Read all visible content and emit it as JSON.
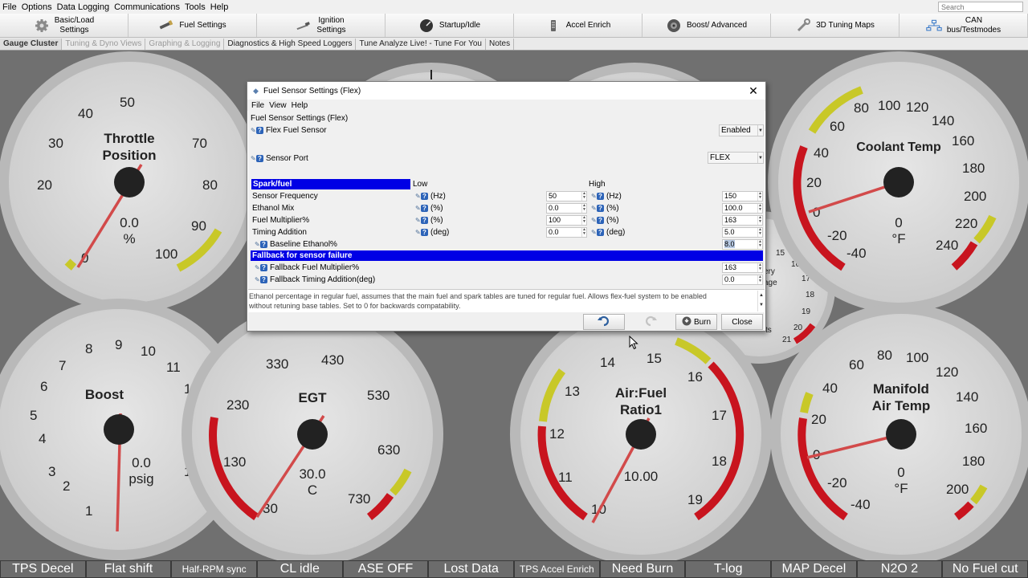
{
  "menubar": [
    "File",
    "Options",
    "Data Logging",
    "Communications",
    "Tools",
    "Help"
  ],
  "search_placeholder": "Search",
  "toolbar": [
    {
      "label": "Basic/Load\nSettings",
      "icon": "gear-icon"
    },
    {
      "label": "Fuel Settings",
      "icon": "fuel-injector-icon"
    },
    {
      "label": "Ignition\nSettings",
      "icon": "spark-plug-icon"
    },
    {
      "label": "Startup/Idle",
      "icon": "gauge-icon"
    },
    {
      "label": "Accel Enrich",
      "icon": "pedal-icon"
    },
    {
      "label": "Boost/ Advanced",
      "icon": "turbo-icon"
    },
    {
      "label": "3D Tuning Maps",
      "icon": "wrench-icon"
    },
    {
      "label": "CAN\nbus/Testmodes",
      "icon": "network-icon"
    }
  ],
  "subtabs": [
    {
      "label": "Gauge Cluster",
      "state": "active"
    },
    {
      "label": "Tuning & Dyno Views",
      "state": "dim"
    },
    {
      "label": "Graphing & Logging",
      "state": "dim"
    },
    {
      "label": "Diagnostics & High Speed Loggers",
      "state": "norm"
    },
    {
      "label": "Tune Analyze Live! - Tune For You",
      "state": "norm"
    },
    {
      "label": "Notes",
      "state": "norm"
    }
  ],
  "gauges": {
    "throttle": {
      "title1": "Throttle",
      "title2": "Position",
      "value": "0.0",
      "unit": "%",
      "ticks": [
        "0",
        "20",
        "30",
        "40",
        "50",
        "70",
        "80",
        "90",
        "100"
      ]
    },
    "coolant": {
      "title": "Coolant Temp",
      "value": "0",
      "unit": "°F",
      "ticks": [
        "-40",
        "-20",
        "0",
        "20",
        "40",
        "60",
        "80",
        "100",
        "120",
        "140",
        "160",
        "180",
        "200",
        "220",
        "240"
      ]
    },
    "boost": {
      "title": "Boost",
      "value": "0.0",
      "unit": "psig",
      "ticks": [
        "1",
        "2",
        "3",
        "4",
        "5",
        "6",
        "7",
        "8",
        "9",
        "10",
        "11",
        "12",
        "15"
      ]
    },
    "egt": {
      "title": "EGT",
      "value": "30.0",
      "unit": "C",
      "ticks": [
        "30",
        "130",
        "230",
        "330",
        "430",
        "530",
        "630",
        "730"
      ]
    },
    "afr": {
      "title1": "Air:Fuel",
      "title2": "Ratio1",
      "value": "10.00",
      "ticks": [
        "10",
        "11",
        "12",
        "13",
        "14",
        "15",
        "16",
        "17",
        "18",
        "19"
      ]
    },
    "mat": {
      "title1": "Manifold",
      "title2": "Air Temp",
      "value": "0",
      "unit": "°F",
      "ticks": [
        "-40",
        "-20",
        "0",
        "20",
        "40",
        "60",
        "80",
        "100",
        "120",
        "140",
        "160",
        "180",
        "200"
      ]
    },
    "battery": {
      "ticks": [
        "15",
        "16",
        "17",
        "18",
        "19",
        "20",
        "21"
      ],
      "label_fragments": [
        "ery",
        "age",
        "ts"
      ]
    }
  },
  "indicators": [
    "TPS Decel",
    "Flat shift",
    "Half-RPM sync",
    "CL idle",
    "ASE OFF",
    "Lost Data",
    "TPS Accel Enrich",
    "Need Burn",
    "T-log",
    "MAP Decel",
    "N2O 2",
    "No Fuel cut"
  ],
  "dialog": {
    "title": "Fuel Sensor Settings (Flex)",
    "menu": [
      "File",
      "View",
      "Help"
    ],
    "heading": "Fuel Sensor Settings (Flex)",
    "flex_label": "Flex Fuel Sensor",
    "flex_value": "Enabled",
    "port_label": "Sensor Port",
    "port_value": "FLEX",
    "section1": "Spark/fuel",
    "low_header": "Low",
    "high_header": "High",
    "rows": [
      {
        "label": "Sensor Frequency",
        "unit": "(Hz)",
        "low": "50",
        "high": "150"
      },
      {
        "label": "Ethanol Mix",
        "unit": "(%)",
        "low": "0.0",
        "high": "100.0"
      },
      {
        "label": "Fuel Multiplier%",
        "unit": "(%)",
        "low": "100",
        "high": "163"
      },
      {
        "label": "Timing Addition",
        "unit": "(deg)",
        "low": "0.0",
        "high": "5.0"
      }
    ],
    "baseline_label": "Baseline Ethanol%",
    "baseline_value": "8.0",
    "section2": "Fallback for sensor failure",
    "fallback_fuel_label": "Fallback Fuel Multiplier%",
    "fallback_fuel_value": "163",
    "fallback_timing_label": "Fallback Timing Addition(deg)",
    "fallback_timing_value": "0.0",
    "help_line1": "Ethanol percentage in regular fuel, assumes that the main fuel and spark tables are tuned for regular fuel. Allows flex-fuel system to be enabled",
    "help_line2": "without retuning base tables. Set to 0 for backwards compatability.",
    "burn_label": "Burn",
    "close_label": "Close"
  },
  "colors": {
    "dialog_section": "#0000e5",
    "gauge_red": "#c8141e",
    "gauge_yellow": "#c8c828",
    "needle": "#d24a4a"
  }
}
